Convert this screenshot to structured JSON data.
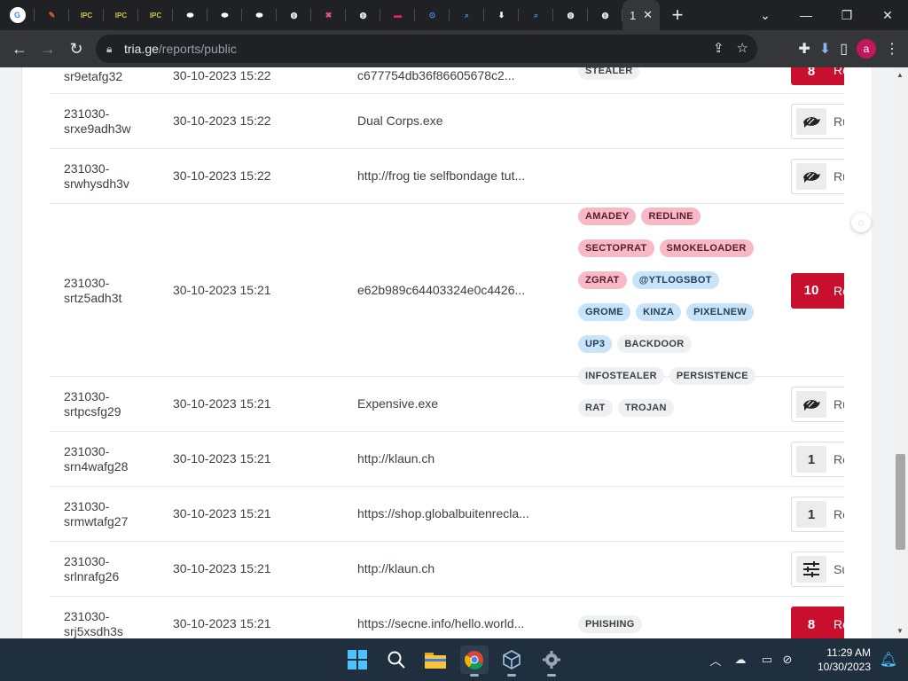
{
  "browser": {
    "tabs": [
      {
        "icon": "google-icon",
        "color": "#ffffff",
        "glyph": "G"
      },
      {
        "icon": "feather-icon",
        "color": "#e25c2b",
        "glyph": "✎"
      },
      {
        "icon": "ipc-icon",
        "color": "#d4c24a",
        "glyph": "IPC"
      },
      {
        "icon": "ipc-icon",
        "color": "#d4c24a",
        "glyph": "IPC"
      },
      {
        "icon": "ipc-icon",
        "color": "#d4c24a",
        "glyph": "IPC"
      },
      {
        "icon": "pill-icon",
        "color": "#ffffff",
        "glyph": "⬬"
      },
      {
        "icon": "pill-icon",
        "color": "#ffffff",
        "glyph": "⬬"
      },
      {
        "icon": "pill-icon",
        "color": "#ffffff",
        "glyph": "⬬"
      },
      {
        "icon": "globe-icon",
        "color": "#ffffff",
        "glyph": "◍"
      },
      {
        "icon": "bookmark-icon",
        "color": "#e8567b",
        "glyph": "✖"
      },
      {
        "icon": "globe-icon",
        "color": "#ffffff",
        "glyph": "◍"
      },
      {
        "icon": "red-badge-icon",
        "color": "#e0245e",
        "glyph": "▬"
      },
      {
        "icon": "search-lens-icon",
        "color": "#4a90e2",
        "glyph": "⊙"
      },
      {
        "icon": "search-icon",
        "color": "#4a90e2",
        "glyph": "⌕"
      },
      {
        "icon": "download-icon",
        "color": "#ffffff",
        "glyph": "⬇"
      },
      {
        "icon": "search-icon",
        "color": "#4a90e2",
        "glyph": "⌕"
      },
      {
        "icon": "globe-icon",
        "color": "#ffffff",
        "glyph": "◍"
      },
      {
        "icon": "globe-icon",
        "color": "#ffffff",
        "glyph": "◍"
      }
    ],
    "active_tab_label": "1",
    "url_host": "tria.ge",
    "url_path": "/reports/public",
    "profile_initial": "a"
  },
  "reports": [
    {
      "id": "sr9etafg32",
      "date": "30-10-2023 15:22",
      "target": "c677754db36f86605678c2...",
      "tags": [
        {
          "text": "STEALER",
          "style": "gray"
        }
      ],
      "score": "8",
      "score_label": "Re",
      "score_style": "red"
    },
    {
      "id": "231030-\nsrxe9adh3w",
      "date": "30-10-2023 15:22",
      "target": "Dual Corps.exe",
      "tags": [],
      "score": "",
      "score_icon": "turtle-icon",
      "score_label": "Ru",
      "score_style": "plain"
    },
    {
      "id": "231030-\nsrwhysdh3v",
      "date": "30-10-2023 15:22",
      "target": "http://frog tie selfbondage tut...",
      "tags": [],
      "score": "",
      "score_icon": "turtle-icon",
      "score_label": "Ru",
      "score_style": "plain"
    },
    {
      "id": "231030-\nsrtz5adh3t",
      "date": "30-10-2023 15:21",
      "target": "e62b989c64403324e0c4426...",
      "tags": [
        {
          "text": "AMADEY",
          "style": "red"
        },
        {
          "text": "REDLINE",
          "style": "red"
        },
        {
          "text": "SECTOPRAT",
          "style": "red"
        },
        {
          "text": "SMOKELOADER",
          "style": "red"
        },
        {
          "text": "ZGRAT",
          "style": "red"
        },
        {
          "text": "@YTLOGSBOT",
          "style": "blue"
        },
        {
          "text": "GROME",
          "style": "blue"
        },
        {
          "text": "KINZA",
          "style": "blue"
        },
        {
          "text": "PIXELNEW",
          "style": "blue"
        },
        {
          "text": "UP3",
          "style": "blue"
        },
        {
          "text": "BACKDOOR",
          "style": "gray"
        },
        {
          "text": "INFOSTEALER",
          "style": "gray"
        },
        {
          "text": "PERSISTENCE",
          "style": "gray"
        },
        {
          "text": "RAT",
          "style": "gray"
        },
        {
          "text": "TROJAN",
          "style": "gray"
        }
      ],
      "score": "10",
      "score_label": "Re",
      "score_style": "red"
    },
    {
      "id": "231030-\nsrtpcsfg29",
      "date": "30-10-2023 15:21",
      "target": "Expensive.exe",
      "tags": [],
      "score": "",
      "score_icon": "turtle-icon",
      "score_label": "Ru",
      "score_style": "plain"
    },
    {
      "id": "231030-\nsrn4wafg28",
      "date": "30-10-2023 15:21",
      "target": "http://klaun.ch",
      "tags": [],
      "score": "1",
      "score_label": "Re",
      "score_style": "plain"
    },
    {
      "id": "231030-\nsrmwtafg27",
      "date": "30-10-2023 15:21",
      "target": "https://shop.globalbuitenrecla...",
      "tags": [],
      "score": "1",
      "score_label": "Re",
      "score_style": "plain"
    },
    {
      "id": "231030-\nsrlnrafg26",
      "date": "30-10-2023 15:21",
      "target": "http://klaun.ch",
      "tags": [],
      "score": "",
      "score_icon": "sliders-icon",
      "score_label": "Su",
      "score_style": "plain"
    },
    {
      "id": "231030-\nsrj5xsdh3s",
      "date": "30-10-2023 15:21",
      "target": "https://secne.info/hello.world...",
      "tags": [
        {
          "text": "PHISHING",
          "style": "gray"
        }
      ],
      "score": "8",
      "score_label": "Re",
      "score_style": "red"
    }
  ],
  "taskbar": {
    "apps": [
      "windows-start-icon",
      "search-icon",
      "file-explorer-icon",
      "chrome-icon",
      "virtualbox-icon",
      "settings-icon"
    ],
    "time": "11:29 AM",
    "date": "10/30/2023"
  }
}
